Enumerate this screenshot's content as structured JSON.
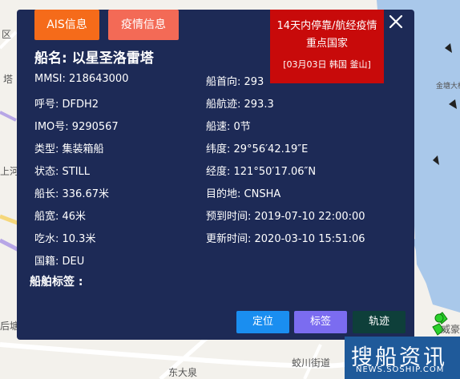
{
  "tabs": {
    "ais": "AIS信息",
    "epidemic": "疫情信息"
  },
  "ship_name": "船名: 以星圣洛雷塔",
  "warning": {
    "title": "14天内停靠/航经疫情重点国家",
    "detail": "[03月03日 韩国 釜山]"
  },
  "fields_left": [
    "MMSI: 218643000",
    "呼号: DFDH2",
    "IMO号: 9290567",
    "类型: 集装箱船",
    "状态: STILL",
    "船长: 336.67米",
    "船宽: 46米",
    "吃水: 10.3米",
    "国籍: DEU"
  ],
  "fields_right": [
    "船首向: 293",
    "船航迹: 293.3",
    "船速: 0节",
    "纬度: 29°56′42.19″E",
    "经度: 121°50′17.06″N",
    "目的地: CNSHA",
    "预到时间: 2019-07-10 22:00:00",
    "更新时间: 2020-03-10 15:51:06"
  ],
  "tags_label": "船舶标签 :",
  "buttons": {
    "locate": "定位",
    "tag": "标签",
    "track": "轨迹"
  },
  "map_labels": {
    "district_left": "区",
    "canal": "上河",
    "tower": "塔",
    "jiedao": "街道",
    "tuoqiao": "后塘",
    "jiaochuan": "蛟川街道",
    "donghai": "东大泉",
    "weiqiao": "威豪",
    "jintang": "金塘大桥",
    "qiao": "桥"
  },
  "watermark": {
    "cn": "搜船资讯",
    "url": "NEWS.SOSHIP.COM"
  },
  "colors": {
    "panel": "#1d2a56",
    "ais_tab": "#f56b1a",
    "epi_tab": "#f36a56",
    "warning": "#c80a0a",
    "locate": "#1a8ef0",
    "tag": "#7b6cf0",
    "track": "#0e3f3a"
  }
}
